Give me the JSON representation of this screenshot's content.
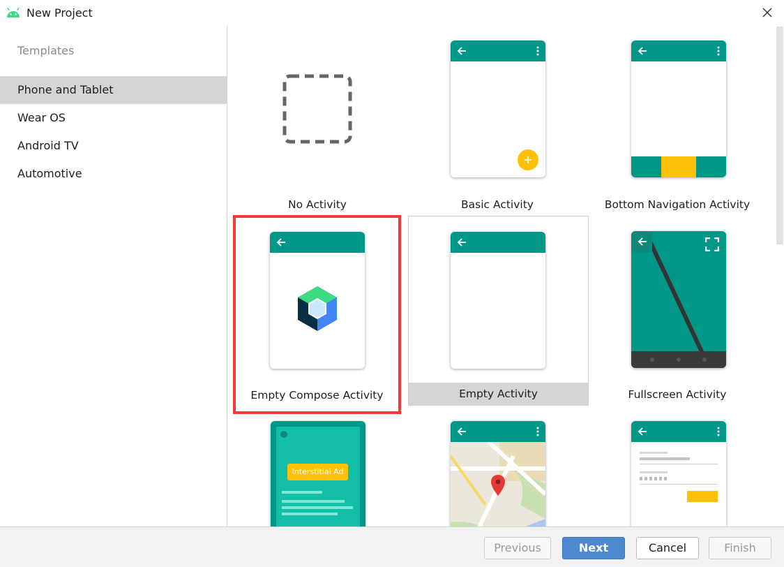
{
  "window": {
    "title": "New Project",
    "app_icon": "android-icon",
    "close_icon": "close-icon"
  },
  "sidebar": {
    "section_label": "Templates",
    "items": [
      {
        "label": "Phone and Tablet",
        "selected": true
      },
      {
        "label": "Wear OS",
        "selected": false
      },
      {
        "label": "Android TV",
        "selected": false
      },
      {
        "label": "Automotive",
        "selected": false
      }
    ]
  },
  "templates": [
    {
      "label": "No Activity"
    },
    {
      "label": "Basic Activity"
    },
    {
      "label": "Bottom Navigation Activity"
    },
    {
      "label": "Empty Compose Activity",
      "highlighted": true
    },
    {
      "label": "Empty Activity",
      "hovered": true
    },
    {
      "label": "Fullscreen Activity"
    },
    {
      "label": "",
      "badge": "Interstitial Ad"
    },
    {
      "label": ""
    },
    {
      "label": ""
    }
  ],
  "footer": {
    "previous": "Previous",
    "next": "Next",
    "cancel": "Cancel",
    "finish": "Finish"
  },
  "colors": {
    "teal": "#009688",
    "amber": "#FFC107",
    "highlight": "#EF3B3B",
    "primary_button": "#4D88D0",
    "selected_bg": "#D5D5D5"
  }
}
